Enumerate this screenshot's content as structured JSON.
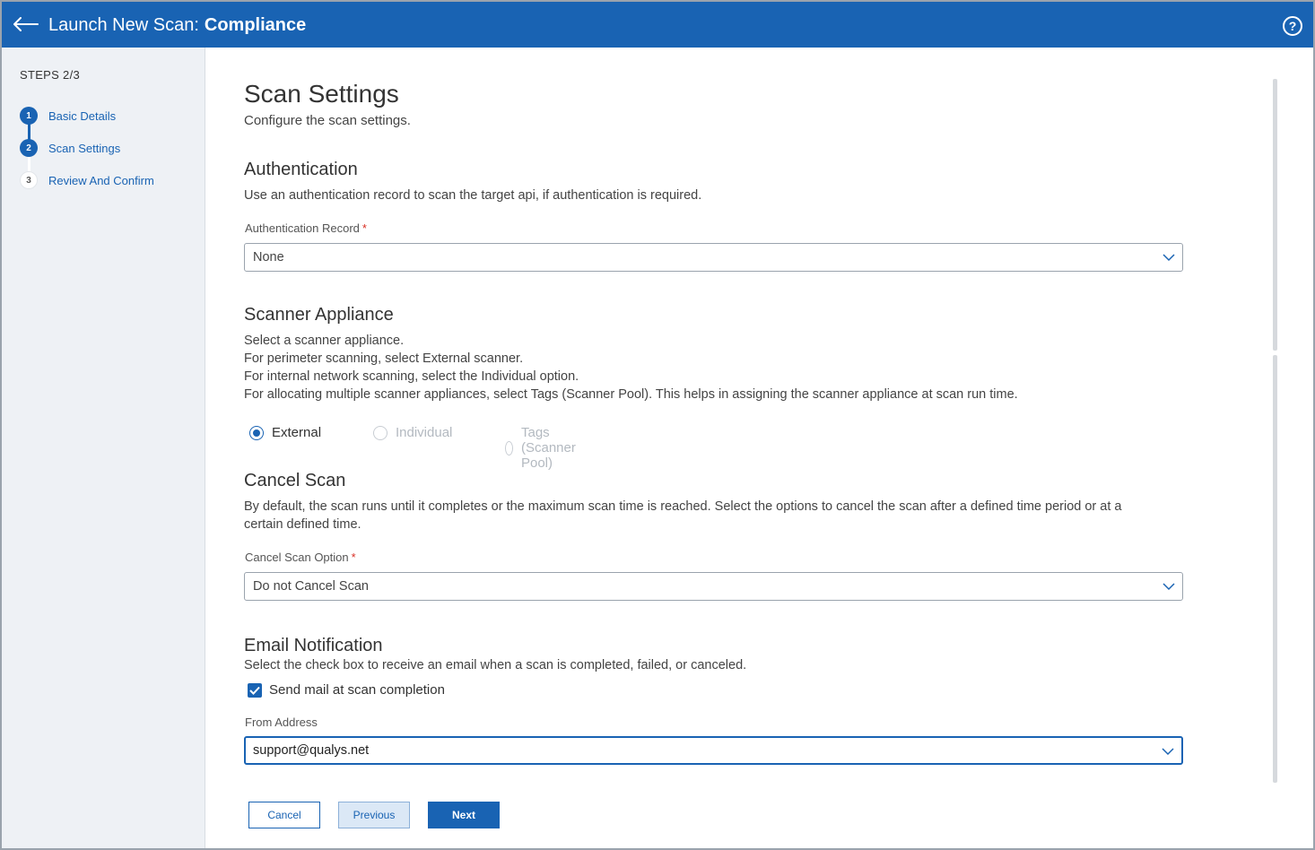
{
  "header": {
    "title": "Launch New Scan:",
    "subtitle": "Compliance",
    "help_icon": "question-circle-icon",
    "back_icon": "arrow-left-icon"
  },
  "sidebar": {
    "steps_label": "STEPS 2/3",
    "steps": [
      {
        "number": "1",
        "label": "Basic Details",
        "state": "done"
      },
      {
        "number": "2",
        "label": "Scan Settings",
        "state": "current"
      },
      {
        "number": "3",
        "label": "Review And Confirm",
        "state": "todo"
      }
    ]
  },
  "main": {
    "title": "Scan Settings",
    "subtitle": "Configure the scan settings.",
    "authentication": {
      "title": "Authentication",
      "description": "Use an authentication record to scan the target api, if authentication is required.",
      "field_label": "Authentication Record",
      "required_mark": "*",
      "value": "None"
    },
    "scanner_appliance": {
      "title": "Scanner Appliance",
      "description_lines": [
        "Select a scanner appliance.",
        "For perimeter scanning, select External scanner.",
        "For internal network scanning, select the Individual option.",
        "For allocating multiple scanner appliances, select Tags (Scanner Pool). This helps in assigning the scanner appliance at scan run time."
      ],
      "options": [
        {
          "label": "External",
          "selected": true,
          "disabled": false
        },
        {
          "label": "Individual",
          "selected": false,
          "disabled": true
        },
        {
          "label": "Tags (Scanner Pool)",
          "selected": false,
          "disabled": true
        }
      ]
    },
    "cancel_scan": {
      "title": "Cancel Scan",
      "description_lines": [
        "By default, the scan runs until it completes or the maximum scan time is reached. Select the options to cancel the scan after a defined time period or at a",
        "certain defined time."
      ],
      "field_label": "Cancel Scan Option",
      "required_mark": "*",
      "value": "Do not Cancel Scan"
    },
    "email_notification": {
      "title": "Email Notification",
      "description": "Select the check box to receive an email when a scan is completed, failed, or canceled.",
      "checkbox_label": "Send mail at scan completion",
      "checked": true,
      "from_label": "From Address",
      "from_value": "support@qualys.net"
    },
    "buttons": {
      "cancel": "Cancel",
      "previous": "Previous",
      "next": "Next"
    }
  },
  "colors": {
    "primary": "#1963b3",
    "sidebar_bg": "#eef1f5",
    "required": "#d93025"
  }
}
